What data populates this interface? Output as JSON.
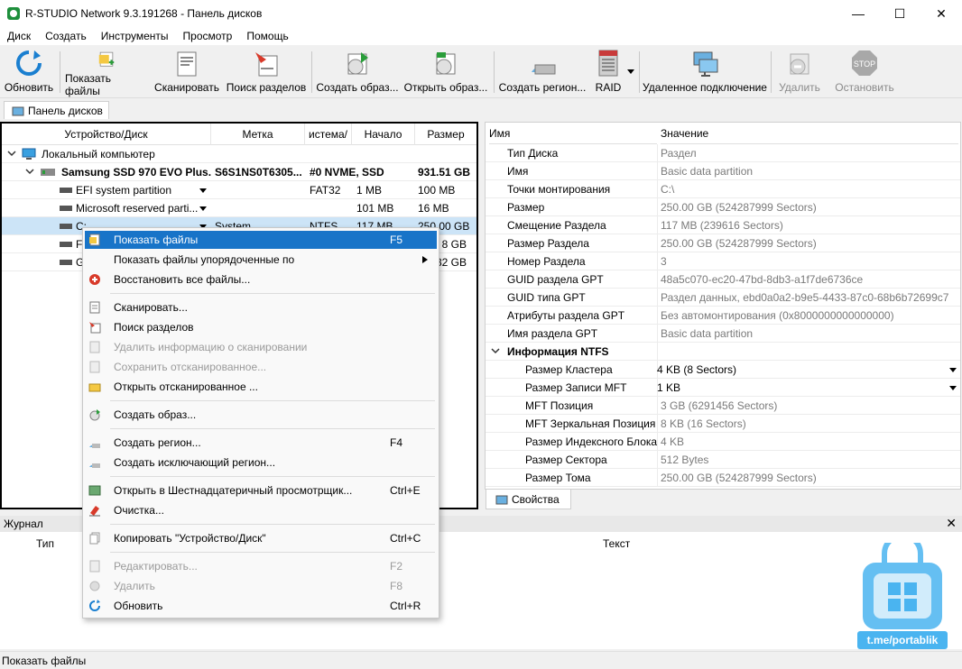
{
  "window": {
    "title": "R-STUDIO Network 9.3.191268 - Панель дисков",
    "minimize": "—",
    "maximize": "☐",
    "close": "✕"
  },
  "menu": [
    "Диск",
    "Создать",
    "Инструменты",
    "Просмотр",
    "Помощь"
  ],
  "toolbar": {
    "refresh": "Обновить",
    "show_files": "Показать файлы",
    "scan": "Сканировать",
    "find_partitions": "Поиск разделов",
    "create_image": "Создать образ...",
    "open_image": "Открыть образ...",
    "create_region": "Создать регион...",
    "raid": "RAID",
    "remote": "Удаленное подключение",
    "delete": "Удалить",
    "stop": "Остановить"
  },
  "tab": {
    "disk_panel": "Панель дисков",
    "properties": "Свойства"
  },
  "left": {
    "headers": [
      "Устройство/Диск",
      "Метка",
      "истема/",
      "Начало",
      "Размер"
    ],
    "computer": "Локальный компьютер",
    "ssd": {
      "name": "Samsung SSD 970 EVO Plus...",
      "label": "S6S1NS0T6305...",
      "fs": "#0 NVME, SSD",
      "size": "931.51 GB"
    },
    "parts": [
      {
        "name": "EFI system partition",
        "label": "",
        "fs": "FAT32",
        "start": "1 MB",
        "size": "100 MB"
      },
      {
        "name": "Microsoft reserved parti...",
        "label": "",
        "fs": "",
        "start": "101 MB",
        "size": "16 MB"
      },
      {
        "name": "C:",
        "label": "System",
        "fs": "NTFS",
        "start": "117 MB",
        "size": "250.00 GB"
      },
      {
        "name": "F:",
        "label": "",
        "fs": "",
        "start": "",
        "size": "8 GB"
      },
      {
        "name": "G",
        "label": "",
        "fs": "",
        "start": "",
        "size": "32 GB"
      }
    ]
  },
  "right": {
    "headers": [
      "Имя",
      "Значение"
    ],
    "rows": [
      {
        "k": "Тип Диска",
        "v": "Раздел"
      },
      {
        "k": "Имя",
        "v": "Basic data partition"
      },
      {
        "k": "Точки монтирования",
        "v": "C:\\"
      },
      {
        "k": "Размер",
        "v": "250.00 GB (524287999 Sectors)"
      },
      {
        "k": "Смещение Раздела",
        "v": "117 MB (239616 Sectors)"
      },
      {
        "k": "Размер Раздела",
        "v": "250.00 GB (524287999 Sectors)"
      },
      {
        "k": "Номер Раздела",
        "v": "3"
      },
      {
        "k": "GUID раздела GPT",
        "v": "48a5c070-ec20-47bd-8db3-a1f7de6736ce"
      },
      {
        "k": "GUID типа GPT",
        "v": "Раздел данных, ebd0a0a2-b9e5-4433-87c0-68b6b72699c7"
      },
      {
        "k": "Атрибуты раздела GPT",
        "v": "Без автомонтирования (0x8000000000000000)"
      },
      {
        "k": "Имя раздела GPT",
        "v": "Basic data partition"
      }
    ],
    "ntfs_group": "Информация NTFS",
    "ntfs_rows": [
      {
        "k": "Размер Кластера",
        "v": "4 KB (8 Sectors)"
      },
      {
        "k": "Размер Записи MFT",
        "v": "1 KB"
      },
      {
        "k": "MFT Позиция",
        "v": "3 GB (6291456 Sectors)"
      },
      {
        "k": "MFT Зеркальная Позиция",
        "v": "8 KB (16 Sectors)"
      },
      {
        "k": "Размер Индексного Блока",
        "v": "4 KB"
      },
      {
        "k": "Размер Сектора",
        "v": "512 Bytes"
      },
      {
        "k": "Размер Тома",
        "v": "250.00 GB (524287999 Sectors)"
      }
    ]
  },
  "context_menu": [
    {
      "label": "Показать файлы",
      "shortcut": "F5"
    },
    {
      "label": "Показать файлы упорядоченные по",
      "shortcut": ""
    },
    {
      "label": "Восстановить все файлы...",
      "shortcut": ""
    },
    {
      "label": "Сканировать...",
      "shortcut": ""
    },
    {
      "label": "Поиск разделов",
      "shortcut": ""
    },
    {
      "label": "Удалить информацию о сканировании",
      "shortcut": ""
    },
    {
      "label": "Сохранить отсканированное...",
      "shortcut": ""
    },
    {
      "label": "Открыть отсканированное ...",
      "shortcut": ""
    },
    {
      "label": "Создать образ...",
      "shortcut": ""
    },
    {
      "label": "Создать регион...",
      "shortcut": "F4"
    },
    {
      "label": "Создать исключающий регион...",
      "shortcut": ""
    },
    {
      "label": "Открыть в Шестнадцатеричный просмотрщик...",
      "shortcut": "Ctrl+E"
    },
    {
      "label": "Очистка...",
      "shortcut": ""
    },
    {
      "label": "Копировать \"Устройство/Диск\"",
      "shortcut": "Ctrl+C"
    },
    {
      "label": "Редактировать...",
      "shortcut": "F2"
    },
    {
      "label": "Удалить",
      "shortcut": "F8"
    },
    {
      "label": "Обновить",
      "shortcut": "Ctrl+R"
    }
  ],
  "journal": {
    "title": "Журнал",
    "close": "✕",
    "col_type": "Тип",
    "col_text": "Текст"
  },
  "status": "Показать файлы",
  "watermark": {
    "text": "t.me/portablik"
  },
  "colors": {
    "accent": "#1874c8",
    "selection": "#cce4f7",
    "watermark": "#4ab4f0"
  }
}
